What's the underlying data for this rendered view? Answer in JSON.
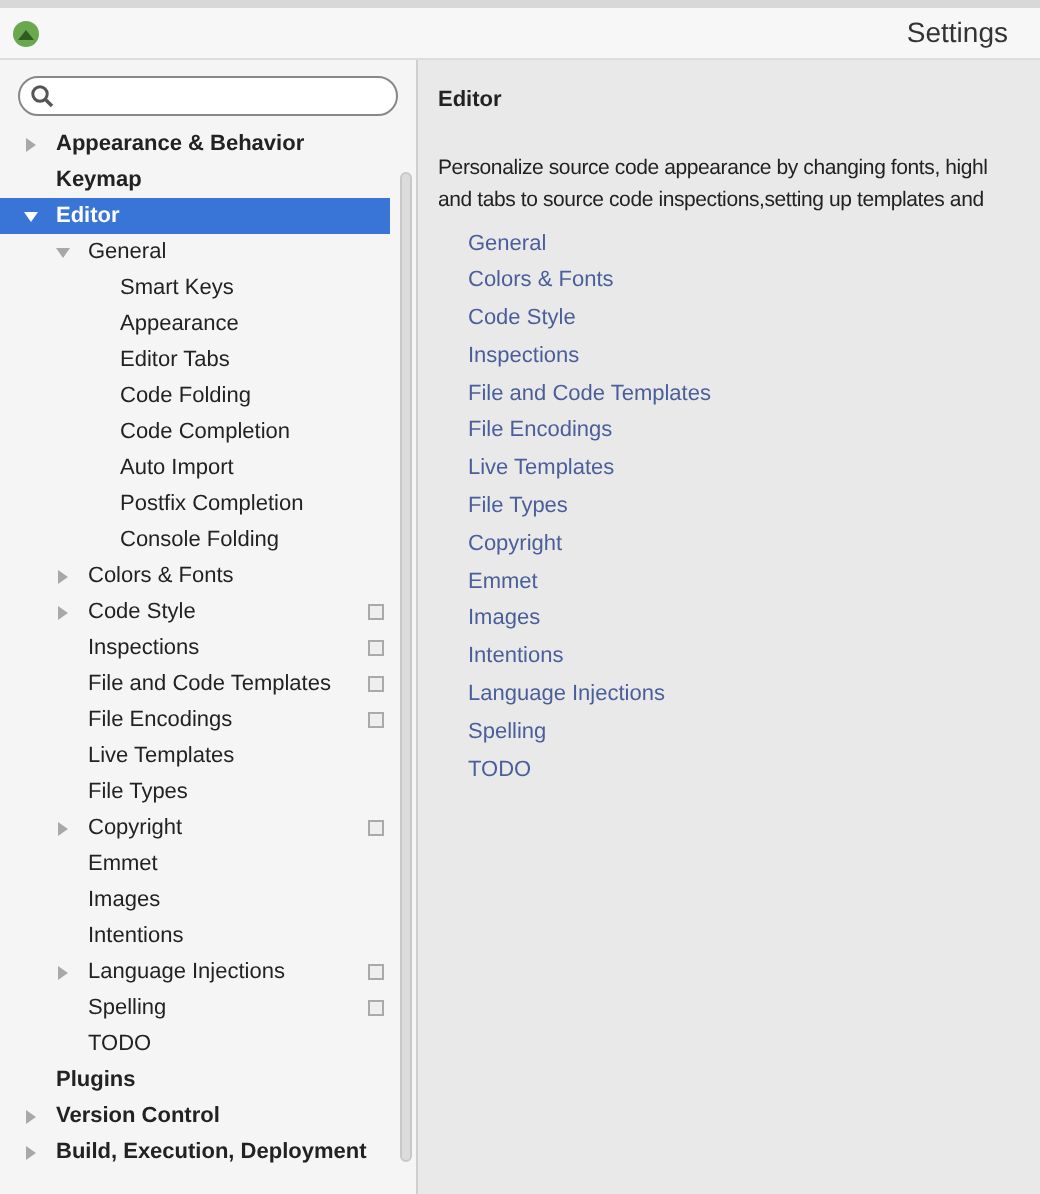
{
  "window": {
    "title": "Settings"
  },
  "tree": [
    {
      "label": "Appearance & Behavior",
      "selected": false,
      "expanded": false,
      "scoped": false
    },
    {
      "label": "Keymap",
      "selected": false,
      "scoped": false
    },
    {
      "label": "Editor",
      "selected": true,
      "expanded": true,
      "scoped": false,
      "children": [
        {
          "label": "General",
          "selected": false,
          "expanded": true,
          "scoped": false,
          "children": [
            {
              "label": "Smart Keys",
              "selected": false,
              "scoped": false
            },
            {
              "label": "Appearance",
              "selected": false,
              "scoped": false
            },
            {
              "label": "Editor Tabs",
              "selected": false,
              "scoped": false
            },
            {
              "label": "Code Folding",
              "selected": false,
              "scoped": false
            },
            {
              "label": "Code Completion",
              "selected": false,
              "scoped": false
            },
            {
              "label": "Auto Import",
              "selected": false,
              "scoped": false
            },
            {
              "label": "Postfix Completion",
              "selected": false,
              "scoped": false
            },
            {
              "label": "Console Folding",
              "selected": false,
              "scoped": false
            }
          ]
        },
        {
          "label": "Colors & Fonts",
          "selected": false,
          "expanded": false,
          "scoped": false
        },
        {
          "label": "Code Style",
          "selected": false,
          "expanded": false,
          "scoped": true
        },
        {
          "label": "Inspections",
          "selected": false,
          "scoped": true
        },
        {
          "label": "File and Code Templates",
          "selected": false,
          "scoped": true
        },
        {
          "label": "File Encodings",
          "selected": false,
          "scoped": true
        },
        {
          "label": "Live Templates",
          "selected": false,
          "scoped": false
        },
        {
          "label": "File Types",
          "selected": false,
          "scoped": false
        },
        {
          "label": "Copyright",
          "selected": false,
          "expanded": false,
          "scoped": true
        },
        {
          "label": "Emmet",
          "selected": false,
          "scoped": false
        },
        {
          "label": "Images",
          "selected": false,
          "scoped": false
        },
        {
          "label": "Intentions",
          "selected": false,
          "scoped": false
        },
        {
          "label": "Language Injections",
          "selected": false,
          "expanded": false,
          "scoped": true
        },
        {
          "label": "Spelling",
          "selected": false,
          "scoped": true
        },
        {
          "label": "TODO",
          "selected": false,
          "scoped": false
        }
      ]
    },
    {
      "label": "Plugins",
      "selected": false,
      "scoped": false
    },
    {
      "label": "Version Control",
      "selected": false,
      "expanded": false,
      "scoped": false
    },
    {
      "label": "Build, Execution, Deployment",
      "selected": false,
      "expanded": false,
      "scoped": false
    }
  ],
  "content": {
    "title": "Editor",
    "description": [
      "Personalize source code appearance by changing fonts, highl",
      "and tabs to source code inspections,setting up templates and"
    ],
    "links": [
      "General",
      "Colors & Fonts",
      "Code Style",
      "Inspections",
      "File and Code Templates",
      "File Encodings",
      "Live Templates",
      "File Types",
      "Copyright",
      "Emmet",
      "Images",
      "Intentions",
      "Language Injections",
      "Spelling",
      "TODO"
    ]
  }
}
